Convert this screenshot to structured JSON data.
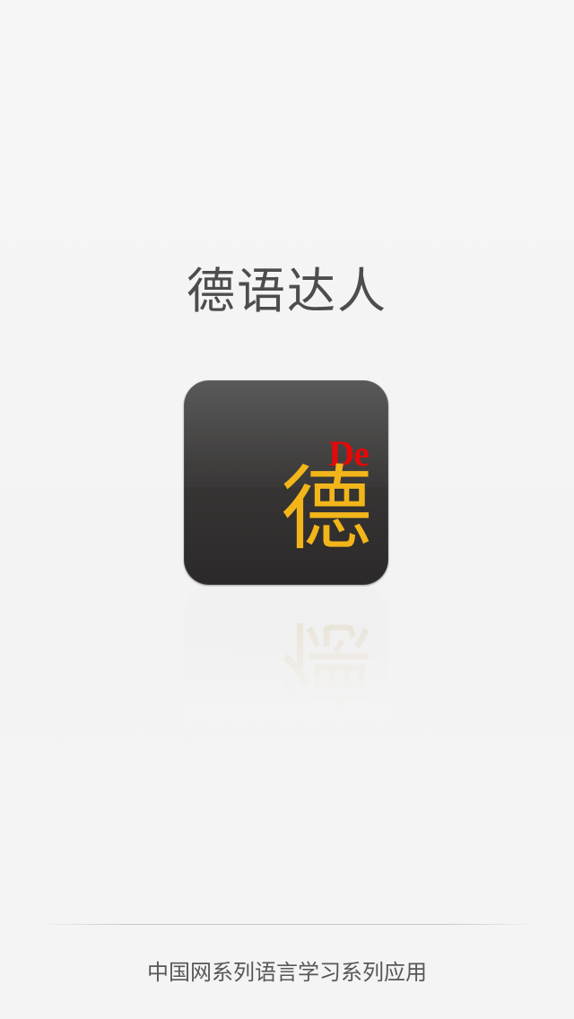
{
  "splash": {
    "title": "德语达人",
    "icon": {
      "name": "de-app-icon",
      "label_top": "De",
      "label_main": "德",
      "colors": {
        "background_top": "#474646",
        "background_bottom": "#2b2929",
        "label_top": "#e50808",
        "label_main": "#f2b51a"
      }
    },
    "footer": "中国网系列语言学习系列应用"
  }
}
